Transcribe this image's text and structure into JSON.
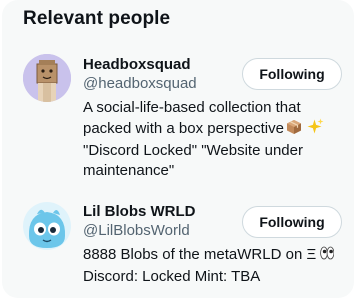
{
  "section": {
    "title": "Relevant people"
  },
  "people": [
    {
      "name": "Headboxsquad",
      "handle": "@headboxsquad",
      "follow_label": "Following",
      "bio_lines": [
        "A social-life-based collection that",
        "packed with a box perspective",
        "\"Discord Locked\" \"Website under",
        "maintenance\""
      ],
      "bio_emojis": [
        "package-emoji",
        "sparkles-emoji"
      ],
      "avatar_icon": "box-head-avatar"
    },
    {
      "name": "Lil Blobs WRLD",
      "handle": "@LilBlobsWorld",
      "follow_label": "Following",
      "bio_lines": [
        "8888 Blobs of the metaWRLD on Ξ",
        "Discord: Locked Mint: TBA"
      ],
      "bio_emojis": [
        "eyes-emoji"
      ],
      "avatar_icon": "blue-blob-avatar"
    }
  ],
  "colors": {
    "card_bg": "#f7f9f9",
    "text": "#0f1419",
    "secondary_text": "#536471",
    "button_border": "#cfd9de"
  }
}
